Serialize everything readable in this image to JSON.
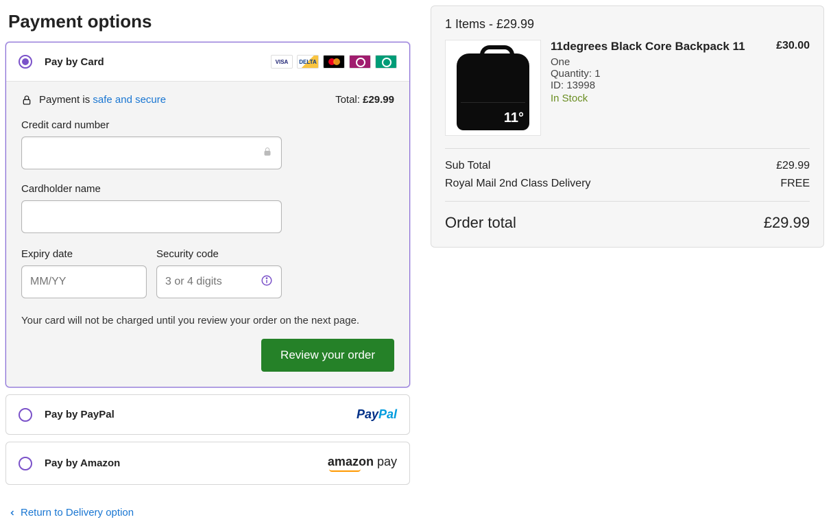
{
  "page": {
    "title": "Payment options",
    "return_link": "Return to Delivery option"
  },
  "options": {
    "card": {
      "label": "Pay by Card"
    },
    "paypal": {
      "label": "Pay by PayPal"
    },
    "amazon": {
      "label": "Pay by Amazon"
    }
  },
  "card_form": {
    "secure_prefix": "Payment is ",
    "secure_link": "safe and secure",
    "total_label": "Total: ",
    "total_value": "£29.99",
    "cc_label": "Credit card number",
    "name_label": "Cardholder name",
    "expiry_label": "Expiry date",
    "expiry_placeholder": "MM/YY",
    "cvc_label": "Security code",
    "cvc_placeholder": "3 or 4 digits",
    "note": "Your card will not be charged until you review your order on the next page.",
    "submit": "Review your order"
  },
  "summary": {
    "head": "1 Items - £29.99",
    "item": {
      "title": "11degrees Black Core Backpack 11",
      "variant": "One",
      "qty": "Quantity: 1",
      "id": "ID: 13998",
      "stock": "In Stock",
      "price": "£30.00",
      "thumb_label": "11°"
    },
    "subtotal_label": "Sub Total",
    "subtotal_value": "£29.99",
    "shipping_label": "Royal Mail 2nd Class Delivery",
    "shipping_value": "FREE",
    "total_label": "Order total",
    "total_value": "£29.99"
  }
}
